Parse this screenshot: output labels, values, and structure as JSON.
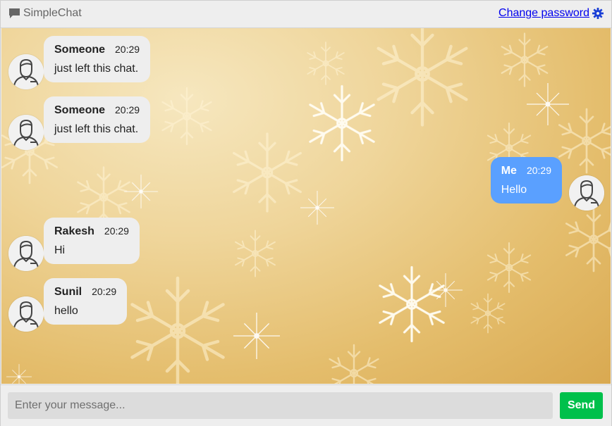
{
  "header": {
    "brand": "SimpleChat",
    "brand_icon": "chat-bubble-icon",
    "change_password_label": "Change password",
    "change_password_icon": "gear-icon"
  },
  "messages": [
    {
      "name": "Someone",
      "time": "20:29",
      "text": "just left this chat.",
      "side": "left"
    },
    {
      "name": "Someone",
      "time": "20:29",
      "text": "just left this chat.",
      "side": "left"
    },
    {
      "name": "Me",
      "time": "20:29",
      "text": "Hello",
      "side": "right"
    },
    {
      "name": "Rakesh",
      "time": "20:29",
      "text": "Hi",
      "side": "left"
    },
    {
      "name": "Sunil",
      "time": "20:29",
      "text": "hello",
      "side": "left"
    }
  ],
  "composer": {
    "placeholder": "Enter your message...",
    "value": "",
    "send_label": "Send"
  },
  "colors": {
    "accent_me_bubble": "#5aa0ff",
    "send_button": "#00c04b",
    "link": "#0000ee"
  }
}
